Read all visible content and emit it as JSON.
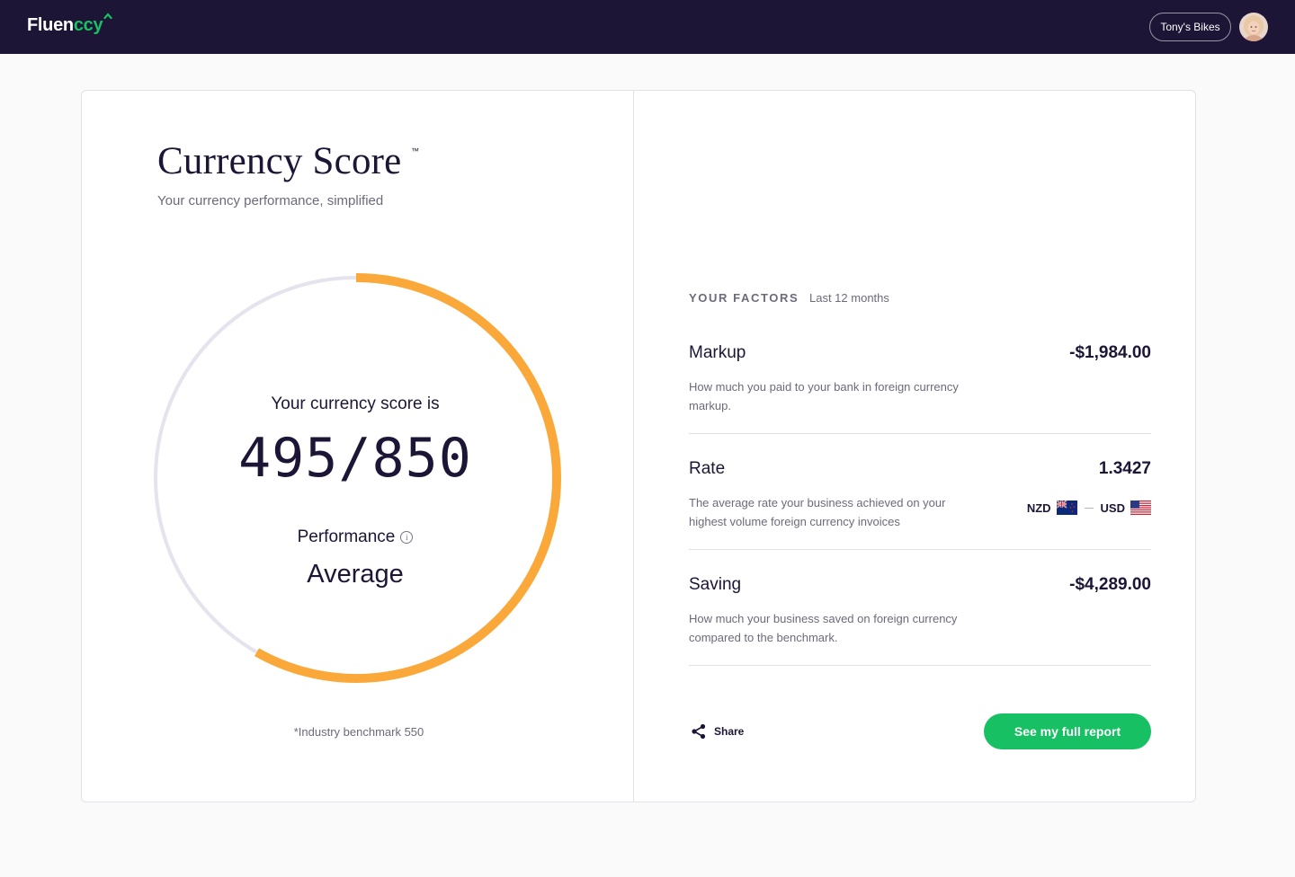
{
  "app": {
    "brand_part1": "Fluen",
    "brand_part2": "ccy",
    "account_name": "Tony's Bikes",
    "colors": {
      "navy": "#1c1535",
      "green": "#17c063",
      "orange": "#fba83a",
      "track": "#e4e3ee"
    }
  },
  "score_panel": {
    "title": "Currency Score",
    "trademark": "™",
    "subtitle": "Your currency performance, simplified",
    "score_label": "Your currency score is",
    "score": 495,
    "score_max": 850,
    "score_text": "495/850",
    "performance_label": "Performance",
    "performance_value": "Average",
    "benchmark_text": "*Industry benchmark 550"
  },
  "factors": {
    "heading": "YOUR FACTORS",
    "period": "Last 12 months",
    "items": [
      {
        "name": "Markup",
        "value": "-$1,984.00",
        "description": "How much you paid to your bank in foreign currency markup."
      },
      {
        "name": "Rate",
        "value": "1.3427",
        "description": "The average rate your business achieved on your highest volume foreign currency invoices",
        "from_currency": "NZD",
        "to_currency": "USD"
      },
      {
        "name": "Saving",
        "value": "-$4,289.00",
        "description": "How much your business saved on foreign currency compared to the benchmark."
      }
    ]
  },
  "actions": {
    "share_label": "Share",
    "report_label": "See my full report"
  }
}
